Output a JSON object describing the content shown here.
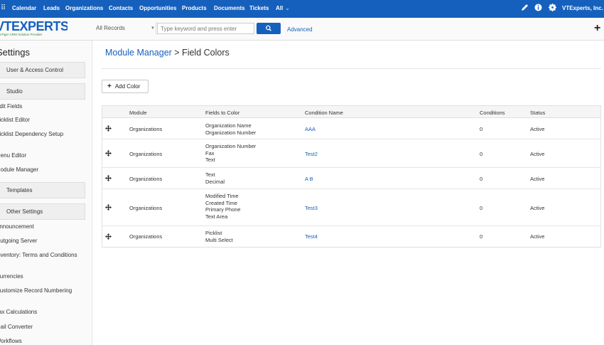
{
  "topnav": {
    "items": [
      "Calendar",
      "Leads",
      "Organizations",
      "Contacts",
      "Opportunities",
      "Products",
      "Documents",
      "Tickets",
      "All"
    ],
    "user": "VTExperts, Inc."
  },
  "header": {
    "logo_text_a": "VTE",
    "logo_text_b": "X",
    "logo_text_c": "PERTS",
    "logo_sub": "vTiger CRM Solution Provider",
    "records_select": "All Records",
    "search_placeholder": "Type keyword and press enter",
    "advanced_label": "Advanced"
  },
  "sidebar": {
    "title": "Settings",
    "user_access": "User & Access Control",
    "studio": "Studio",
    "studio_links": [
      "Edit Fields",
      "Picklist Editor",
      "Picklist Dependency Setup",
      "Menu Editor",
      "Module Manager"
    ],
    "templates": "Templates",
    "other": "Other Settings",
    "other_links": [
      "Announcement",
      "Outgoing Server",
      "Inventory: Terms and Conditions",
      "Currencies",
      "Customize Record Numbering",
      "Tax Calculations",
      "Mail Converter",
      "Workflows"
    ]
  },
  "main": {
    "breadcrumb": "Module Manager",
    "title": " > Field Colors",
    "add_color_label": "Add Color",
    "columns": [
      "Module",
      "Fields to Color",
      "Condition Name",
      "Conditions",
      "Status"
    ],
    "rows": [
      {
        "module": "Organizations",
        "fields": [
          "Organization Name",
          "Organization Number"
        ],
        "condition_name": "AAA",
        "conditions": "0",
        "status": "Active"
      },
      {
        "module": "Organizations",
        "fields": [
          "Organization Number",
          "Fax",
          "Text"
        ],
        "condition_name": "Test2",
        "conditions": "0",
        "status": "Active"
      },
      {
        "module": "Organizations",
        "fields": [
          "Text",
          "Decimal"
        ],
        "condition_name": "A B",
        "conditions": "0",
        "status": "Active"
      },
      {
        "module": "Organizations",
        "fields": [
          "Modified Time",
          "Created Time",
          "Primary Phone",
          "Text Area"
        ],
        "condition_name": "Test3",
        "conditions": "0",
        "status": "Active"
      },
      {
        "module": "Organizations",
        "fields": [
          "Picklist",
          "Multi Select"
        ],
        "condition_name": "Test4",
        "conditions": "0",
        "status": "Active"
      }
    ]
  },
  "colors": {
    "brand_blue": "#1560bd",
    "link_blue": "#1560bd"
  }
}
